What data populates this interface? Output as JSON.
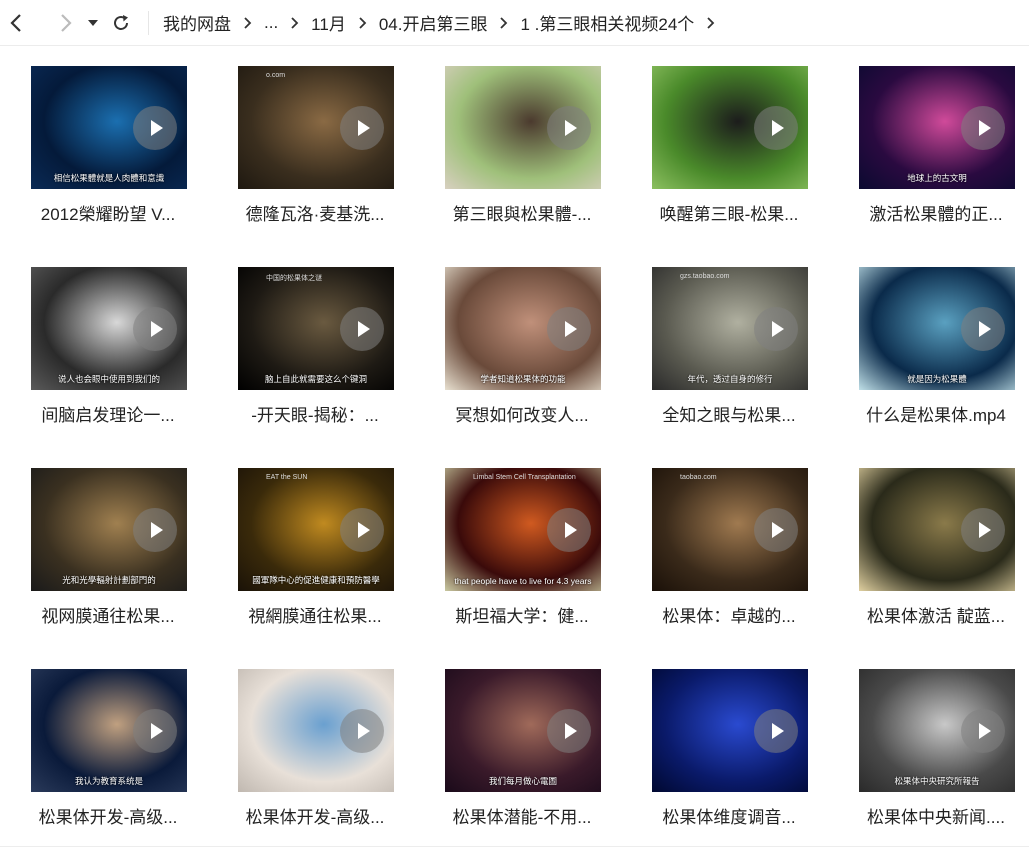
{
  "nav": {
    "back_icon": "chevron-left-icon",
    "forward_icon": "chevron-right-icon",
    "history_icon": "caret-down-icon",
    "refresh_icon": "refresh-icon"
  },
  "breadcrumb": [
    "我的网盘",
    "...",
    "11月",
    "04.开启第三眼",
    "1 .第三眼相关视频24个"
  ],
  "files": [
    {
      "name": "2012榮耀盼望 V...",
      "caption": "相信松果體就是人肉體和意識",
      "mark": "",
      "colors": [
        "#041a3a",
        "#1b6fb0",
        "#0a2a55"
      ]
    },
    {
      "name": "德隆瓦洛·麦基洗...",
      "caption": "",
      "mark": "o.com",
      "colors": [
        "#3a2e1e",
        "#8a6a44",
        "#1e1810"
      ]
    },
    {
      "name": "第三眼與松果體-...",
      "caption": "",
      "mark": "",
      "colors": [
        "#9fc07a",
        "#4b3a2e",
        "#d8d0c0"
      ]
    },
    {
      "name": "唤醒第三眼-松果...",
      "caption": "",
      "mark": "",
      "colors": [
        "#4a8a2a",
        "#1c1c1c",
        "#8cc060"
      ]
    },
    {
      "name": "激活松果體的正...",
      "caption": "地球上的古文明",
      "mark": "",
      "colors": [
        "#2a0a40",
        "#d04a9a",
        "#0a0a30"
      ]
    },
    {
      "name": "间脑启发理论一...",
      "caption": "说人也会眼中使用到我们的",
      "mark": "",
      "colors": [
        "#2a2a2a",
        "#d8d8d8",
        "#5a5a5a"
      ]
    },
    {
      "name": "-开天眼-揭秘：...",
      "caption": "脑上自此就需要这么个键洞",
      "mark": "中国的松果体之谜",
      "colors": [
        "#1e1a14",
        "#6a5a40",
        "#000000"
      ]
    },
    {
      "name": "冥想如何改变人...",
      "caption": "学者知道松果体的功能",
      "mark": "",
      "colors": [
        "#6a4a3a",
        "#c0907a",
        "#e8e0d0"
      ]
    },
    {
      "name": "全知之眼与松果...",
      "caption": "年代，透过自身的修行",
      "mark": "gzs.taobao.com",
      "colors": [
        "#5a5a50",
        "#b0b0a0",
        "#2a2a2a"
      ]
    },
    {
      "name": "什么是松果体.mp4",
      "caption": "就是因为松果體",
      "mark": "",
      "colors": [
        "#0a2a4a",
        "#5aa0c0",
        "#c0e0e8"
      ]
    },
    {
      "name": "视网膜通往松果...",
      "caption": "光和光學輻射計劃部門的",
      "mark": "",
      "colors": [
        "#3a3020",
        "#a08050",
        "#1a1a1a"
      ]
    },
    {
      "name": "視網膜通往松果...",
      "caption": "國軍隊中心的促進健康和預防醫學",
      "mark": "EAT the SUN",
      "colors": [
        "#3a2a0a",
        "#c08a20",
        "#1a1208"
      ]
    },
    {
      "name": "斯坦福大学：健...",
      "caption": "that people have to live for 4.3 years",
      "mark": "Limbal Stem Cell Transplantation",
      "colors": [
        "#3a0a0a",
        "#d05a20",
        "#c8c8a0"
      ]
    },
    {
      "name": "松果体：卓越的...",
      "caption": "",
      "mark": "taobao.com",
      "colors": [
        "#3a2a1a",
        "#a07a50",
        "#1a1008"
      ]
    },
    {
      "name": "松果体激活 靛蓝...",
      "caption": "",
      "mark": "",
      "colors": [
        "#2a2a1a",
        "#8a7a4a",
        "#e0d0a0"
      ]
    },
    {
      "name": "松果体开发-高级...",
      "caption": "我认为教育系统是",
      "mark": "",
      "colors": [
        "#0a1a3a",
        "#c0a080",
        "#2a3a5a"
      ]
    },
    {
      "name": "松果体开发-高级...",
      "caption": "",
      "mark": "",
      "colors": [
        "#e8e0d8",
        "#6aa0d0",
        "#c0b8b0"
      ]
    },
    {
      "name": "松果体潜能-不用...",
      "caption": "我们每月做心電圖",
      "mark": "",
      "colors": [
        "#3a1a2a",
        "#a06a5a",
        "#1a0a1a"
      ]
    },
    {
      "name": "松果体维度调音...",
      "caption": "",
      "mark": "",
      "colors": [
        "#0a1a6a",
        "#2a4ad0",
        "#000830"
      ]
    },
    {
      "name": "松果体中央新闻....",
      "caption": "松果体中央研究所報告",
      "mark": "",
      "colors": [
        "#4a4a4a",
        "#c8c8c8",
        "#2a2a2a"
      ]
    }
  ]
}
